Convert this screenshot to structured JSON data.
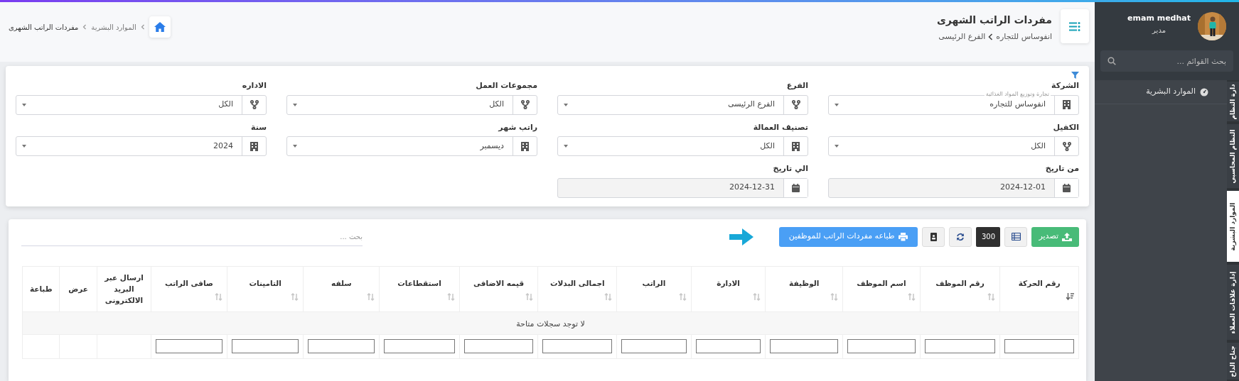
{
  "breadcrumb": {
    "items": [
      {
        "label": "الموارد البشرية"
      },
      {
        "label": "مفردات الراتب الشهرى"
      }
    ]
  },
  "page_header": {
    "title": "مفردات الراتب الشهرى",
    "path": [
      "انفوساس للتجاره",
      "الفرع الرئيسى"
    ]
  },
  "filters": {
    "fields": [
      {
        "label": "الشركة",
        "kind": "select",
        "value": "انفوساس للتجاره",
        "hint": "تجارة وتوزيع المواد الغذائية"
      },
      {
        "label": "الفرع",
        "kind": "select",
        "value": "الفرع الرئيسى"
      },
      {
        "label": "مجموعات العمل",
        "kind": "select",
        "value": "الكل"
      },
      {
        "label": "الاداره",
        "kind": "select",
        "value": "الكل"
      },
      {
        "label": "الكفيل",
        "kind": "select",
        "value": "الكل"
      },
      {
        "label": "تصنيف العمالة",
        "kind": "select",
        "value": "الكل"
      },
      {
        "label": "راتب شهر",
        "kind": "select",
        "value": "ديسمبر"
      },
      {
        "label": "سنة",
        "kind": "select",
        "value": "2024"
      },
      {
        "label": "من تاريخ",
        "kind": "date",
        "value": "2024-12-01"
      },
      {
        "label": "الي تاريخ",
        "kind": "date",
        "value": "2024-12-31"
      }
    ]
  },
  "toolbar": {
    "buttons": [
      {
        "kind": "export",
        "label": "تصدير"
      },
      {
        "kind": "columns"
      },
      {
        "kind": "page-size",
        "label": "300"
      },
      {
        "kind": "refresh"
      },
      {
        "kind": "contact"
      },
      {
        "kind": "print",
        "label": "طباعه مفردات الراتب للموظفين"
      }
    ],
    "search": {
      "placeholder": "بحث ..."
    }
  },
  "table": {
    "columns": [
      {
        "label": "رقم الحركة",
        "sortable": true,
        "sorted": true,
        "filter": true
      },
      {
        "label": "رقم الموظف",
        "sortable": true,
        "sorted": false,
        "filter": true
      },
      {
        "label": "اسم الموظف",
        "sortable": true,
        "sorted": false,
        "filter": true
      },
      {
        "label": "الوظيفة",
        "sortable": true,
        "sorted": false,
        "filter": true
      },
      {
        "label": "الادارة",
        "sortable": true,
        "sorted": false,
        "filter": true
      },
      {
        "label": "الراتب",
        "sortable": true,
        "sorted": false,
        "filter": true
      },
      {
        "label": "اجمالى البدلات",
        "sortable": true,
        "sorted": false,
        "filter": true
      },
      {
        "label": "قيمه الاضافى",
        "sortable": true,
        "sorted": false,
        "filter": true
      },
      {
        "label": "استقطاعات",
        "sortable": true,
        "sorted": false,
        "filter": true
      },
      {
        "label": "سلفه",
        "sortable": true,
        "sorted": false,
        "filter": true
      },
      {
        "label": "التامينات",
        "sortable": true,
        "sorted": false,
        "filter": true
      },
      {
        "label": "صافى الراتب",
        "sortable": true,
        "sorted": false,
        "filter": true
      },
      {
        "label": "ارسال عبر البريد الالكترونى",
        "sortable": false,
        "filter": false
      },
      {
        "label": "عرض",
        "sortable": false,
        "filter": false
      },
      {
        "label": "طباعة",
        "sortable": false,
        "filter": false
      }
    ],
    "empty_message": "لا توجد سجلات متاحة"
  },
  "sidebar": {
    "user": {
      "name": "emam medhat",
      "role": "مدير"
    },
    "search": {
      "placeholder": "بحث القوائم ..."
    },
    "items": [
      {
        "label": "الموارد البشرية"
      }
    ],
    "tabs": [
      {
        "label": "دارة النظام",
        "selected": false
      },
      {
        "label": "النظام المحاسبي",
        "selected": false
      },
      {
        "label": "الموارد البشرية",
        "selected": true
      },
      {
        "label": "إدارة علاقات العملاء",
        "selected": false
      },
      {
        "label": "جناح الداخ",
        "selected": false
      }
    ]
  }
}
